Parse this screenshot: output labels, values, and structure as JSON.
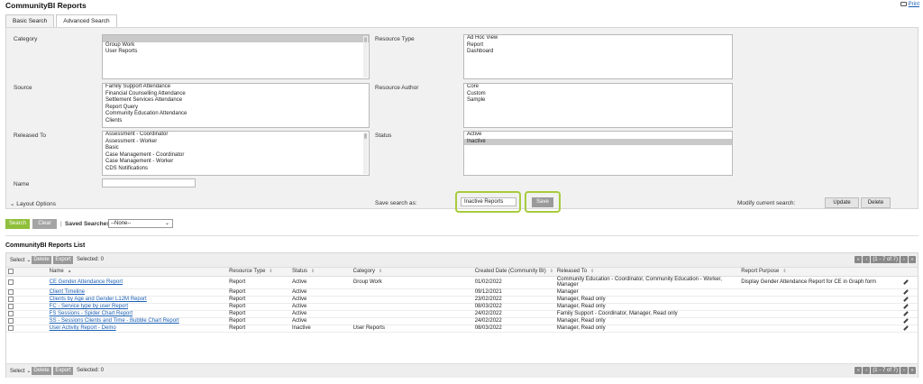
{
  "app": {
    "title": "CommunityBI Reports",
    "print_label": "Print"
  },
  "tabs": [
    {
      "label": "Basic Search"
    },
    {
      "label": "Advanced Search"
    }
  ],
  "filters": {
    "category": {
      "label": "Category",
      "options": [
        "",
        "Group Work",
        "User Reports"
      ]
    },
    "resource_type": {
      "label": "Resource Type",
      "options": [
        "Ad Hoc View",
        "Report",
        "Dashboard"
      ]
    },
    "source": {
      "label": "Source",
      "options": [
        "Family Support Attendance",
        "Financial Counselling Attendance",
        "Settlement Services Attendance",
        "Report Query",
        "Community Education Attendance",
        "Clients"
      ]
    },
    "resource_author": {
      "label": "Resource Author",
      "options": [
        "Core",
        "Custom",
        "Sample"
      ]
    },
    "released_to": {
      "label": "Released To",
      "options": [
        "Assessment - Coordinator",
        "Assessment - Worker",
        "Basic",
        "Case Management - Coordinator",
        "Case Management - Worker",
        "CDS Notifications"
      ]
    },
    "status": {
      "label": "Status",
      "options": [
        "Active",
        "Inactive"
      ],
      "selected": "Inactive"
    },
    "name": {
      "label": "Name",
      "value": ""
    }
  },
  "layout_options": {
    "label": "Layout Options"
  },
  "save_search": {
    "label": "Save search as:",
    "value": "Inactive Reports",
    "save_button": "Save"
  },
  "modify": {
    "label": "Modify current search:",
    "update_button": "Update",
    "delete_button": "Delete"
  },
  "actions": {
    "search_button": "Search",
    "clear_button": "Clear",
    "separator": "|",
    "saved_searches_label": "Saved Searches",
    "saved_searches_value": "--None--"
  },
  "list": {
    "title": "CommunityBI Reports List",
    "toolbar": {
      "select_label": "Select",
      "delete_button": "Delete",
      "export_button": "Export",
      "selected_label": "Selected: 0",
      "pager_text": "(1 - 7 of 7)"
    },
    "columns": {
      "name": "Name",
      "resource_type": "Resource Type",
      "status": "Status",
      "category": "Category",
      "created_date": "Created Date (Community BI)",
      "released_to": "Released To",
      "report_purpose": "Report Purpose"
    },
    "rows": [
      {
        "name": "CE Gender Attendance Report",
        "resource_type": "Report",
        "status": "Active",
        "category": "Group Work",
        "created": "01/02/2022",
        "released_to": "Community Education - Coordinator, Community Education - Worker, Manager",
        "purpose": "Display Gender Attendance Report for CE in Graph form"
      },
      {
        "name": "Client Timeline",
        "resource_type": "Report",
        "status": "Active",
        "category": "",
        "created": "09/12/2021",
        "released_to": "Manager",
        "purpose": ""
      },
      {
        "name": "Clients by Age and Gender L12M Report",
        "resource_type": "Report",
        "status": "Active",
        "category": "",
        "created": "23/02/2022",
        "released_to": "Manager, Read only",
        "purpose": ""
      },
      {
        "name": "FC - Service type by user Report",
        "resource_type": "Report",
        "status": "Active",
        "category": "",
        "created": "08/03/2022",
        "released_to": "Manager, Read only",
        "purpose": ""
      },
      {
        "name": "FS Sessions - Spider Chart Report",
        "resource_type": "Report",
        "status": "Active",
        "category": "",
        "created": "24/02/2022",
        "released_to": "Family Support - Coordinator, Manager, Read only",
        "purpose": ""
      },
      {
        "name": "SS - Sessions Clients and Time - Bubble Chart Report",
        "resource_type": "Report",
        "status": "Active",
        "category": "",
        "created": "24/02/2022",
        "released_to": "Manager, Read only",
        "purpose": ""
      },
      {
        "name": "User Activity Report - Demo",
        "resource_type": "Report",
        "status": "Inactive",
        "category": "User Reports",
        "created": "08/03/2022",
        "released_to": "Manager, Read only",
        "purpose": ""
      }
    ]
  },
  "colors": {
    "accent_green": "#8fbf3a",
    "highlight_green": "#a7cc3c",
    "link_blue": "#1a5fb4"
  }
}
